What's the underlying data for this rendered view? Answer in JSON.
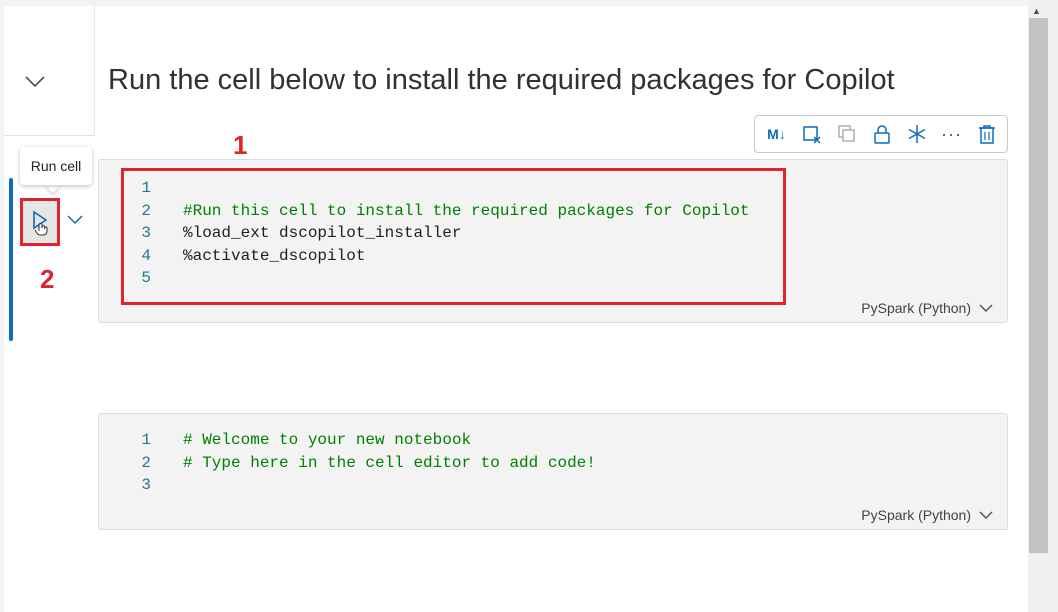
{
  "markdown_cell": {
    "title": "Run the cell below to install the required packages for Copilot"
  },
  "toolbar": {
    "buttons": [
      {
        "name": "markdown-toggle-button",
        "glyph": "M↓",
        "disabled": false
      },
      {
        "name": "clear-output-button",
        "glyph": "▭",
        "disabled": false
      },
      {
        "name": "copy-cell-button",
        "glyph": "⧉",
        "disabled": true
      },
      {
        "name": "lock-cell-button",
        "glyph": "🔒",
        "disabled": false
      },
      {
        "name": "freeze-cell-button",
        "glyph": "✻",
        "disabled": false
      },
      {
        "name": "more-options-button",
        "glyph": "···",
        "disabled": false
      },
      {
        "name": "delete-cell-button",
        "glyph": "🗑",
        "disabled": false
      }
    ]
  },
  "tooltip": {
    "text": "Run cell"
  },
  "annotations": {
    "label1": "1",
    "label2": "2"
  },
  "cells": [
    {
      "language": "PySpark (Python)",
      "lines": [
        {
          "num": "1",
          "text": "",
          "comment": false
        },
        {
          "num": "2",
          "text": "#Run this cell to install the required packages for Copilot",
          "comment": true
        },
        {
          "num": "3",
          "text": "%load_ext dscopilot_installer",
          "comment": false
        },
        {
          "num": "4",
          "text": "%activate_dscopilot",
          "comment": false
        },
        {
          "num": "5",
          "text": "",
          "comment": false
        }
      ]
    },
    {
      "language": "PySpark (Python)",
      "lines": [
        {
          "num": "1",
          "text": "# Welcome to your new notebook",
          "comment": true
        },
        {
          "num": "2",
          "text": "# Type here in the cell editor to add code!",
          "comment": true
        },
        {
          "num": "3",
          "text": "",
          "comment": false
        }
      ]
    }
  ],
  "colors": {
    "accent": "#0f6cbd",
    "annotation": "#e0242b",
    "comment": "#008000",
    "line_number": "#237893"
  }
}
